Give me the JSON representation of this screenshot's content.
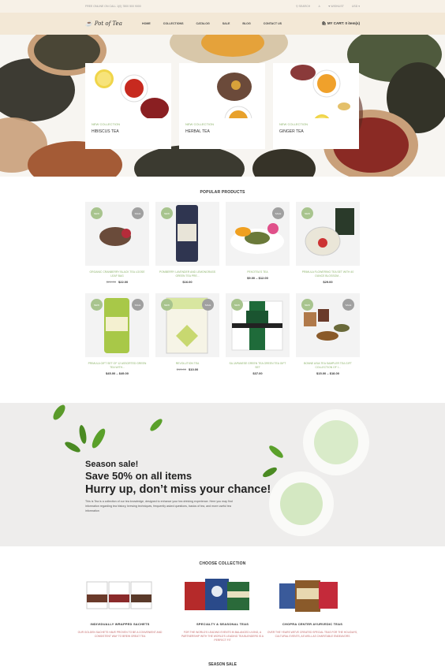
{
  "topbar": {
    "left_text": "FREE ONLINE ON CALL 1(0) 7800 500 9000",
    "search": "SEARCH",
    "wishlist": "WISHLIST",
    "currency": "USD"
  },
  "header": {
    "logo": "Pot of Tea",
    "nav": [
      "HOME",
      "COLLECTIONS",
      "CATALOG",
      "SALE",
      "BLOG",
      "CONTACT US"
    ],
    "cart": "MY CART: 0 item(s)"
  },
  "hero": {
    "categories": [
      {
        "tag": "NEW COLLECTION",
        "name": "HIBISCUS TEA"
      },
      {
        "tag": "NEW COLLECTION",
        "name": "HERBAL TEA"
      },
      {
        "tag": "NEW COLLECTION",
        "name": "GINGER TEA"
      }
    ]
  },
  "popular": {
    "title": "POPULAR PRODUCTS",
    "badge_new": "NEW",
    "badge_sale": "SALE",
    "products": [
      {
        "name": "ORGANIC CRANBERRY BLACK TEA LOOSE LEAF BAG",
        "old_price": "$24.00",
        "price": "$22.00"
      },
      {
        "name": "POMBERRY LAVENDER AND LEMONGRASS GREEN TEA PRE...",
        "old_price": "",
        "price": "$16.00"
      },
      {
        "name": "PEKOTEA'S TEA",
        "old_price": "",
        "price": "$9.00 – $12.00"
      },
      {
        "name": "PRIMULA FLOWERING TEA SET WITH 40 OUNCE BLOSSOM...",
        "old_price": "",
        "price": "$29.00"
      },
      {
        "name": "PRIMULA GIFT SET OF 12 ASSORTED GREEN TEA WITH...",
        "old_price": "",
        "price": "$45.00 – $49.00"
      },
      {
        "name": "REVOLUTION TEA",
        "old_price": "$13.00",
        "price": "$10.00"
      },
      {
        "name": "SA JAPANESE GREEN TEA GREEN TEA GIFT SET",
        "old_price": "",
        "price": "$37.00"
      },
      {
        "name": "BONNE ASIA TEA SAMPLER TEA GIFT COLLECTION OF I...",
        "old_price": "",
        "price": "$15.00 – $18.00"
      }
    ]
  },
  "promo": {
    "line1": "Season sale!",
    "line2": "Save 50% on all items",
    "line3": "Hurry up, don’t miss your chance!",
    "desc": "This is Tea is a collection of our tea knowledge, designed to enhance your tea drinking experience. Here you may find information regarding tea history, brewing techniques, frequently asked questions, basics of tea, and more useful tea information"
  },
  "collections": {
    "title": "CHOOSE COLLECTION",
    "items": [
      {
        "name": "INDIVIDUALLY WRAPPED SACHETS",
        "desc": "OUR GOLDEN SACHETS HAVE PROVEN TO BE A CONVENIENT AND CONSISTENT WAY TO BREW GREAT TEA"
      },
      {
        "name": "SPECIALTY & SEASONAL TEAS",
        "desc": "FOR THE WORLD'S LEADING EVENTS IN BALANCED LIVING, A PARTNERSHIP WITH THE WORLD'S LEADING TEA BLENDERS IS A PERFECT FIT"
      },
      {
        "name": "CHOPRA CENTER AYURVEDIC TEAS",
        "desc": "OVER THE YEARS WE'VE CREATED SPECIAL TEAS FOR THE HOLIDAYS, CULTURAL EVENTS, AS WELL AS CHARITABLE ENDEAVORS"
      }
    ]
  },
  "next_section": "SEASON SALE"
}
